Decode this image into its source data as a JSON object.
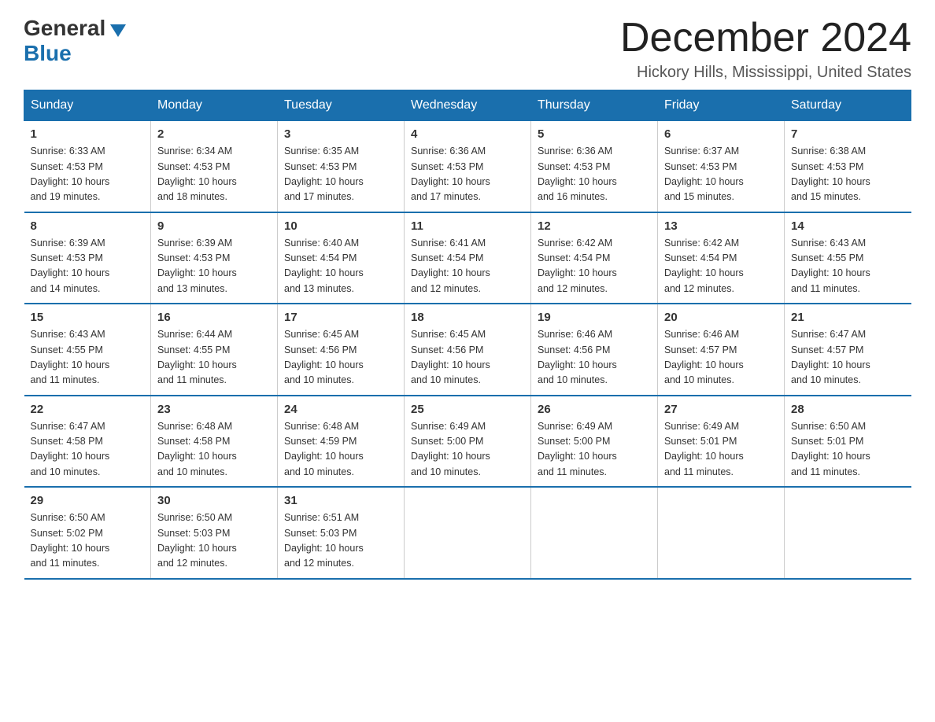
{
  "header": {
    "logo_general": "General",
    "logo_blue": "Blue",
    "month_title": "December 2024",
    "location": "Hickory Hills, Mississippi, United States"
  },
  "days_of_week": [
    "Sunday",
    "Monday",
    "Tuesday",
    "Wednesday",
    "Thursday",
    "Friday",
    "Saturday"
  ],
  "weeks": [
    [
      {
        "day": "1",
        "sunrise": "6:33 AM",
        "sunset": "4:53 PM",
        "daylight": "10 hours and 19 minutes."
      },
      {
        "day": "2",
        "sunrise": "6:34 AM",
        "sunset": "4:53 PM",
        "daylight": "10 hours and 18 minutes."
      },
      {
        "day": "3",
        "sunrise": "6:35 AM",
        "sunset": "4:53 PM",
        "daylight": "10 hours and 17 minutes."
      },
      {
        "day": "4",
        "sunrise": "6:36 AM",
        "sunset": "4:53 PM",
        "daylight": "10 hours and 17 minutes."
      },
      {
        "day": "5",
        "sunrise": "6:36 AM",
        "sunset": "4:53 PM",
        "daylight": "10 hours and 16 minutes."
      },
      {
        "day": "6",
        "sunrise": "6:37 AM",
        "sunset": "4:53 PM",
        "daylight": "10 hours and 15 minutes."
      },
      {
        "day": "7",
        "sunrise": "6:38 AM",
        "sunset": "4:53 PM",
        "daylight": "10 hours and 15 minutes."
      }
    ],
    [
      {
        "day": "8",
        "sunrise": "6:39 AM",
        "sunset": "4:53 PM",
        "daylight": "10 hours and 14 minutes."
      },
      {
        "day": "9",
        "sunrise": "6:39 AM",
        "sunset": "4:53 PM",
        "daylight": "10 hours and 13 minutes."
      },
      {
        "day": "10",
        "sunrise": "6:40 AM",
        "sunset": "4:54 PM",
        "daylight": "10 hours and 13 minutes."
      },
      {
        "day": "11",
        "sunrise": "6:41 AM",
        "sunset": "4:54 PM",
        "daylight": "10 hours and 12 minutes."
      },
      {
        "day": "12",
        "sunrise": "6:42 AM",
        "sunset": "4:54 PM",
        "daylight": "10 hours and 12 minutes."
      },
      {
        "day": "13",
        "sunrise": "6:42 AM",
        "sunset": "4:54 PM",
        "daylight": "10 hours and 12 minutes."
      },
      {
        "day": "14",
        "sunrise": "6:43 AM",
        "sunset": "4:55 PM",
        "daylight": "10 hours and 11 minutes."
      }
    ],
    [
      {
        "day": "15",
        "sunrise": "6:43 AM",
        "sunset": "4:55 PM",
        "daylight": "10 hours and 11 minutes."
      },
      {
        "day": "16",
        "sunrise": "6:44 AM",
        "sunset": "4:55 PM",
        "daylight": "10 hours and 11 minutes."
      },
      {
        "day": "17",
        "sunrise": "6:45 AM",
        "sunset": "4:56 PM",
        "daylight": "10 hours and 10 minutes."
      },
      {
        "day": "18",
        "sunrise": "6:45 AM",
        "sunset": "4:56 PM",
        "daylight": "10 hours and 10 minutes."
      },
      {
        "day": "19",
        "sunrise": "6:46 AM",
        "sunset": "4:56 PM",
        "daylight": "10 hours and 10 minutes."
      },
      {
        "day": "20",
        "sunrise": "6:46 AM",
        "sunset": "4:57 PM",
        "daylight": "10 hours and 10 minutes."
      },
      {
        "day": "21",
        "sunrise": "6:47 AM",
        "sunset": "4:57 PM",
        "daylight": "10 hours and 10 minutes."
      }
    ],
    [
      {
        "day": "22",
        "sunrise": "6:47 AM",
        "sunset": "4:58 PM",
        "daylight": "10 hours and 10 minutes."
      },
      {
        "day": "23",
        "sunrise": "6:48 AM",
        "sunset": "4:58 PM",
        "daylight": "10 hours and 10 minutes."
      },
      {
        "day": "24",
        "sunrise": "6:48 AM",
        "sunset": "4:59 PM",
        "daylight": "10 hours and 10 minutes."
      },
      {
        "day": "25",
        "sunrise": "6:49 AM",
        "sunset": "5:00 PM",
        "daylight": "10 hours and 10 minutes."
      },
      {
        "day": "26",
        "sunrise": "6:49 AM",
        "sunset": "5:00 PM",
        "daylight": "10 hours and 11 minutes."
      },
      {
        "day": "27",
        "sunrise": "6:49 AM",
        "sunset": "5:01 PM",
        "daylight": "10 hours and 11 minutes."
      },
      {
        "day": "28",
        "sunrise": "6:50 AM",
        "sunset": "5:01 PM",
        "daylight": "10 hours and 11 minutes."
      }
    ],
    [
      {
        "day": "29",
        "sunrise": "6:50 AM",
        "sunset": "5:02 PM",
        "daylight": "10 hours and 11 minutes."
      },
      {
        "day": "30",
        "sunrise": "6:50 AM",
        "sunset": "5:03 PM",
        "daylight": "10 hours and 12 minutes."
      },
      {
        "day": "31",
        "sunrise": "6:51 AM",
        "sunset": "5:03 PM",
        "daylight": "10 hours and 12 minutes."
      },
      null,
      null,
      null,
      null
    ]
  ],
  "labels": {
    "sunrise": "Sunrise:",
    "sunset": "Sunset:",
    "daylight": "Daylight:"
  }
}
